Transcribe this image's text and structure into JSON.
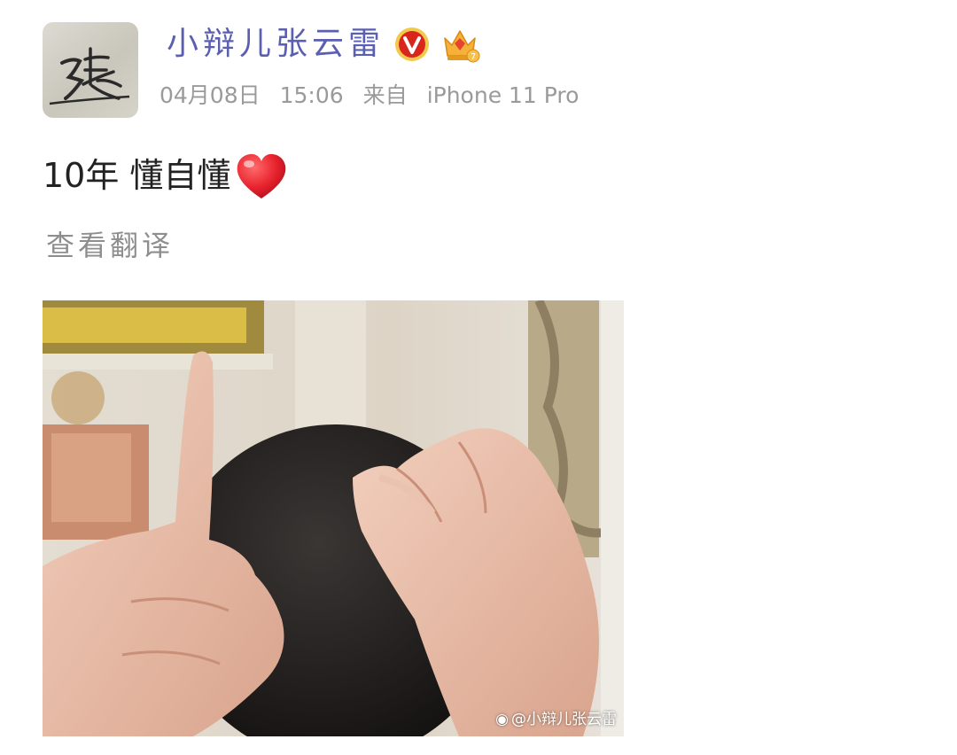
{
  "post": {
    "author": {
      "name": "小辩儿张云雷",
      "avatar_glyph": "張",
      "verified_icon": "verified-v-icon",
      "vip_icon": "crown-vip-icon",
      "vip_level": "7"
    },
    "meta": {
      "date": "04月08日",
      "time": "15:06",
      "source_prefix": "来自",
      "device": "iPhone 11 Pro"
    },
    "content": {
      "text": "10年 懂自懂",
      "emoji": "heart-emoji"
    },
    "translate_link": "查看翻译",
    "image": {
      "description_icon": "photo-image",
      "watermark": "@小辩儿张云雷",
      "watermark_icon": "weibo-logo-icon"
    }
  },
  "colors": {
    "name": "#5b5fb2",
    "meta": "#9a9a9a",
    "text": "#222222",
    "translate": "#8e8e8e",
    "verified": "#d9261c",
    "crown": "#f0a020"
  }
}
